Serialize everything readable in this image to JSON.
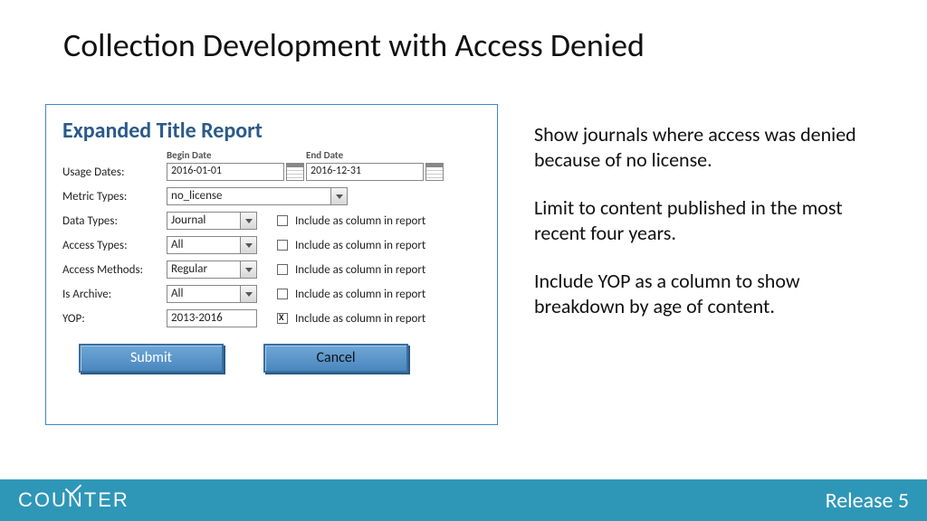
{
  "title": "Collection Development with Access Denied",
  "form": {
    "heading": "Expanded Title Report",
    "begin_date_label": "Begin Date",
    "end_date_label": "End Date",
    "usage_dates_label": "Usage Dates:",
    "begin_date": "2016-01-01",
    "end_date": "2016-12-31",
    "metric_types_label": "Metric Types:",
    "metric_types_value": "no_license",
    "include_col_label": "Include as column in report",
    "rows": {
      "data_types": {
        "label": "Data Types:",
        "value": "Journal"
      },
      "access_types": {
        "label": "Access Types:",
        "value": "All"
      },
      "access_methods": {
        "label": "Access Methods:",
        "value": "Regular"
      },
      "is_archive": {
        "label": "Is Archive:",
        "value": "All"
      },
      "yop": {
        "label": "YOP:",
        "value": "2013-2016"
      }
    },
    "submit_label": "Submit",
    "cancel_label": "Cancel"
  },
  "side": {
    "p1": "Show journals where access was denied because of no license.",
    "p2": "Limit to content published in the most recent four years.",
    "p3": "Include YOP as a column to show breakdown by age of content."
  },
  "footer": {
    "logo_left": "COU",
    "logo_right": "TER",
    "release": "Release 5"
  }
}
